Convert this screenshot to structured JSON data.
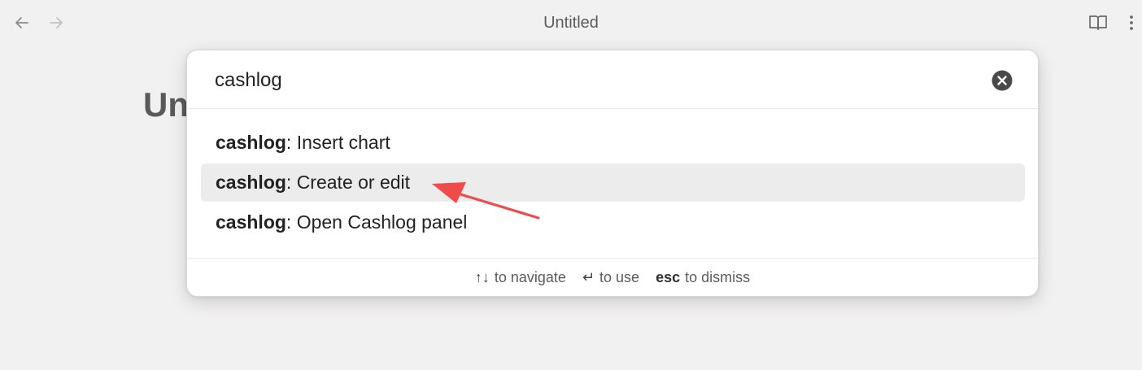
{
  "window": {
    "title": "Untitled"
  },
  "document": {
    "heading": "Untitled"
  },
  "palette": {
    "query": "cashlog",
    "results": [
      {
        "match": "cashlog",
        "rest": ": Insert chart",
        "selected": false
      },
      {
        "match": "cashlog",
        "rest": ": Create or edit",
        "selected": true
      },
      {
        "match": "cashlog",
        "rest": ": Open Cashlog panel",
        "selected": false
      }
    ],
    "hints": {
      "navigate_key": "↑↓",
      "navigate_text": "to navigate",
      "use_key": "↵",
      "use_text": "to use",
      "dismiss_key": "esc",
      "dismiss_text": "to dismiss"
    }
  },
  "icons": {
    "back": "arrow-left-icon",
    "forward": "arrow-right-icon",
    "reading": "book-open-icon",
    "more": "more-vertical-icon",
    "clear": "close-circle-icon",
    "annotation": "red-arrow-annotation"
  },
  "colors": {
    "background": "#f2f1f1",
    "modal": "#ffffff",
    "selected_row": "#ececec",
    "annotation": "#f04b4b"
  }
}
